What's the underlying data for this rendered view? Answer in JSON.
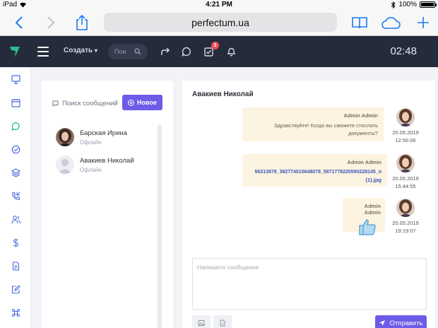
{
  "statusbar": {
    "carrier": "iPad",
    "time": "4:21 PM",
    "battery": "100%"
  },
  "browser": {
    "url": "perfectum.ua"
  },
  "header": {
    "create_label": "Создать",
    "search_placeholder": "Пои",
    "tasks_badge": "3",
    "clock": "02:48"
  },
  "sidebar_icons": [
    "monitor-icon",
    "calendar-icon",
    "chat-icon",
    "check-circle-icon",
    "layers-icon",
    "phone-incoming-icon",
    "users-icon",
    "dollar-icon",
    "document-icon",
    "edit-icon",
    "command-icon"
  ],
  "messages_panel": {
    "search_label": "Поиск сообщений",
    "new_button": "Новое",
    "contacts": [
      {
        "name": "Барская Ирина",
        "status": "Офлайн"
      },
      {
        "name": "Авакиев Николай",
        "status": "Офлайн"
      }
    ]
  },
  "chat": {
    "title": "Авакиев Николай",
    "messages": [
      {
        "author": "Admin Admin",
        "text_line1": "Здравствуйте! Когда вы сможете стослать",
        "text_line2": "документы?",
        "date": "20.05.2019",
        "time": "12:56:06"
      },
      {
        "author": "Admin Admin",
        "file_line1": "56213878_382774515648078_5871778220590228145_n",
        "file_line2": "(1).jpg",
        "date": "20.05.2019",
        "time": "15:44:55"
      },
      {
        "author": "Admin Admin",
        "date": "20.05.2019",
        "time": "19:19:07"
      }
    ],
    "composer_placeholder": "Напишите сообщение",
    "send_button": "Отправить"
  },
  "colors": {
    "accent": "#6c5ce7",
    "header_bg": "#252b3b",
    "bubble_bg": "#fdf3e1",
    "safari_blue": "#1a7cf5",
    "badge_red": "#ef4b5c"
  }
}
